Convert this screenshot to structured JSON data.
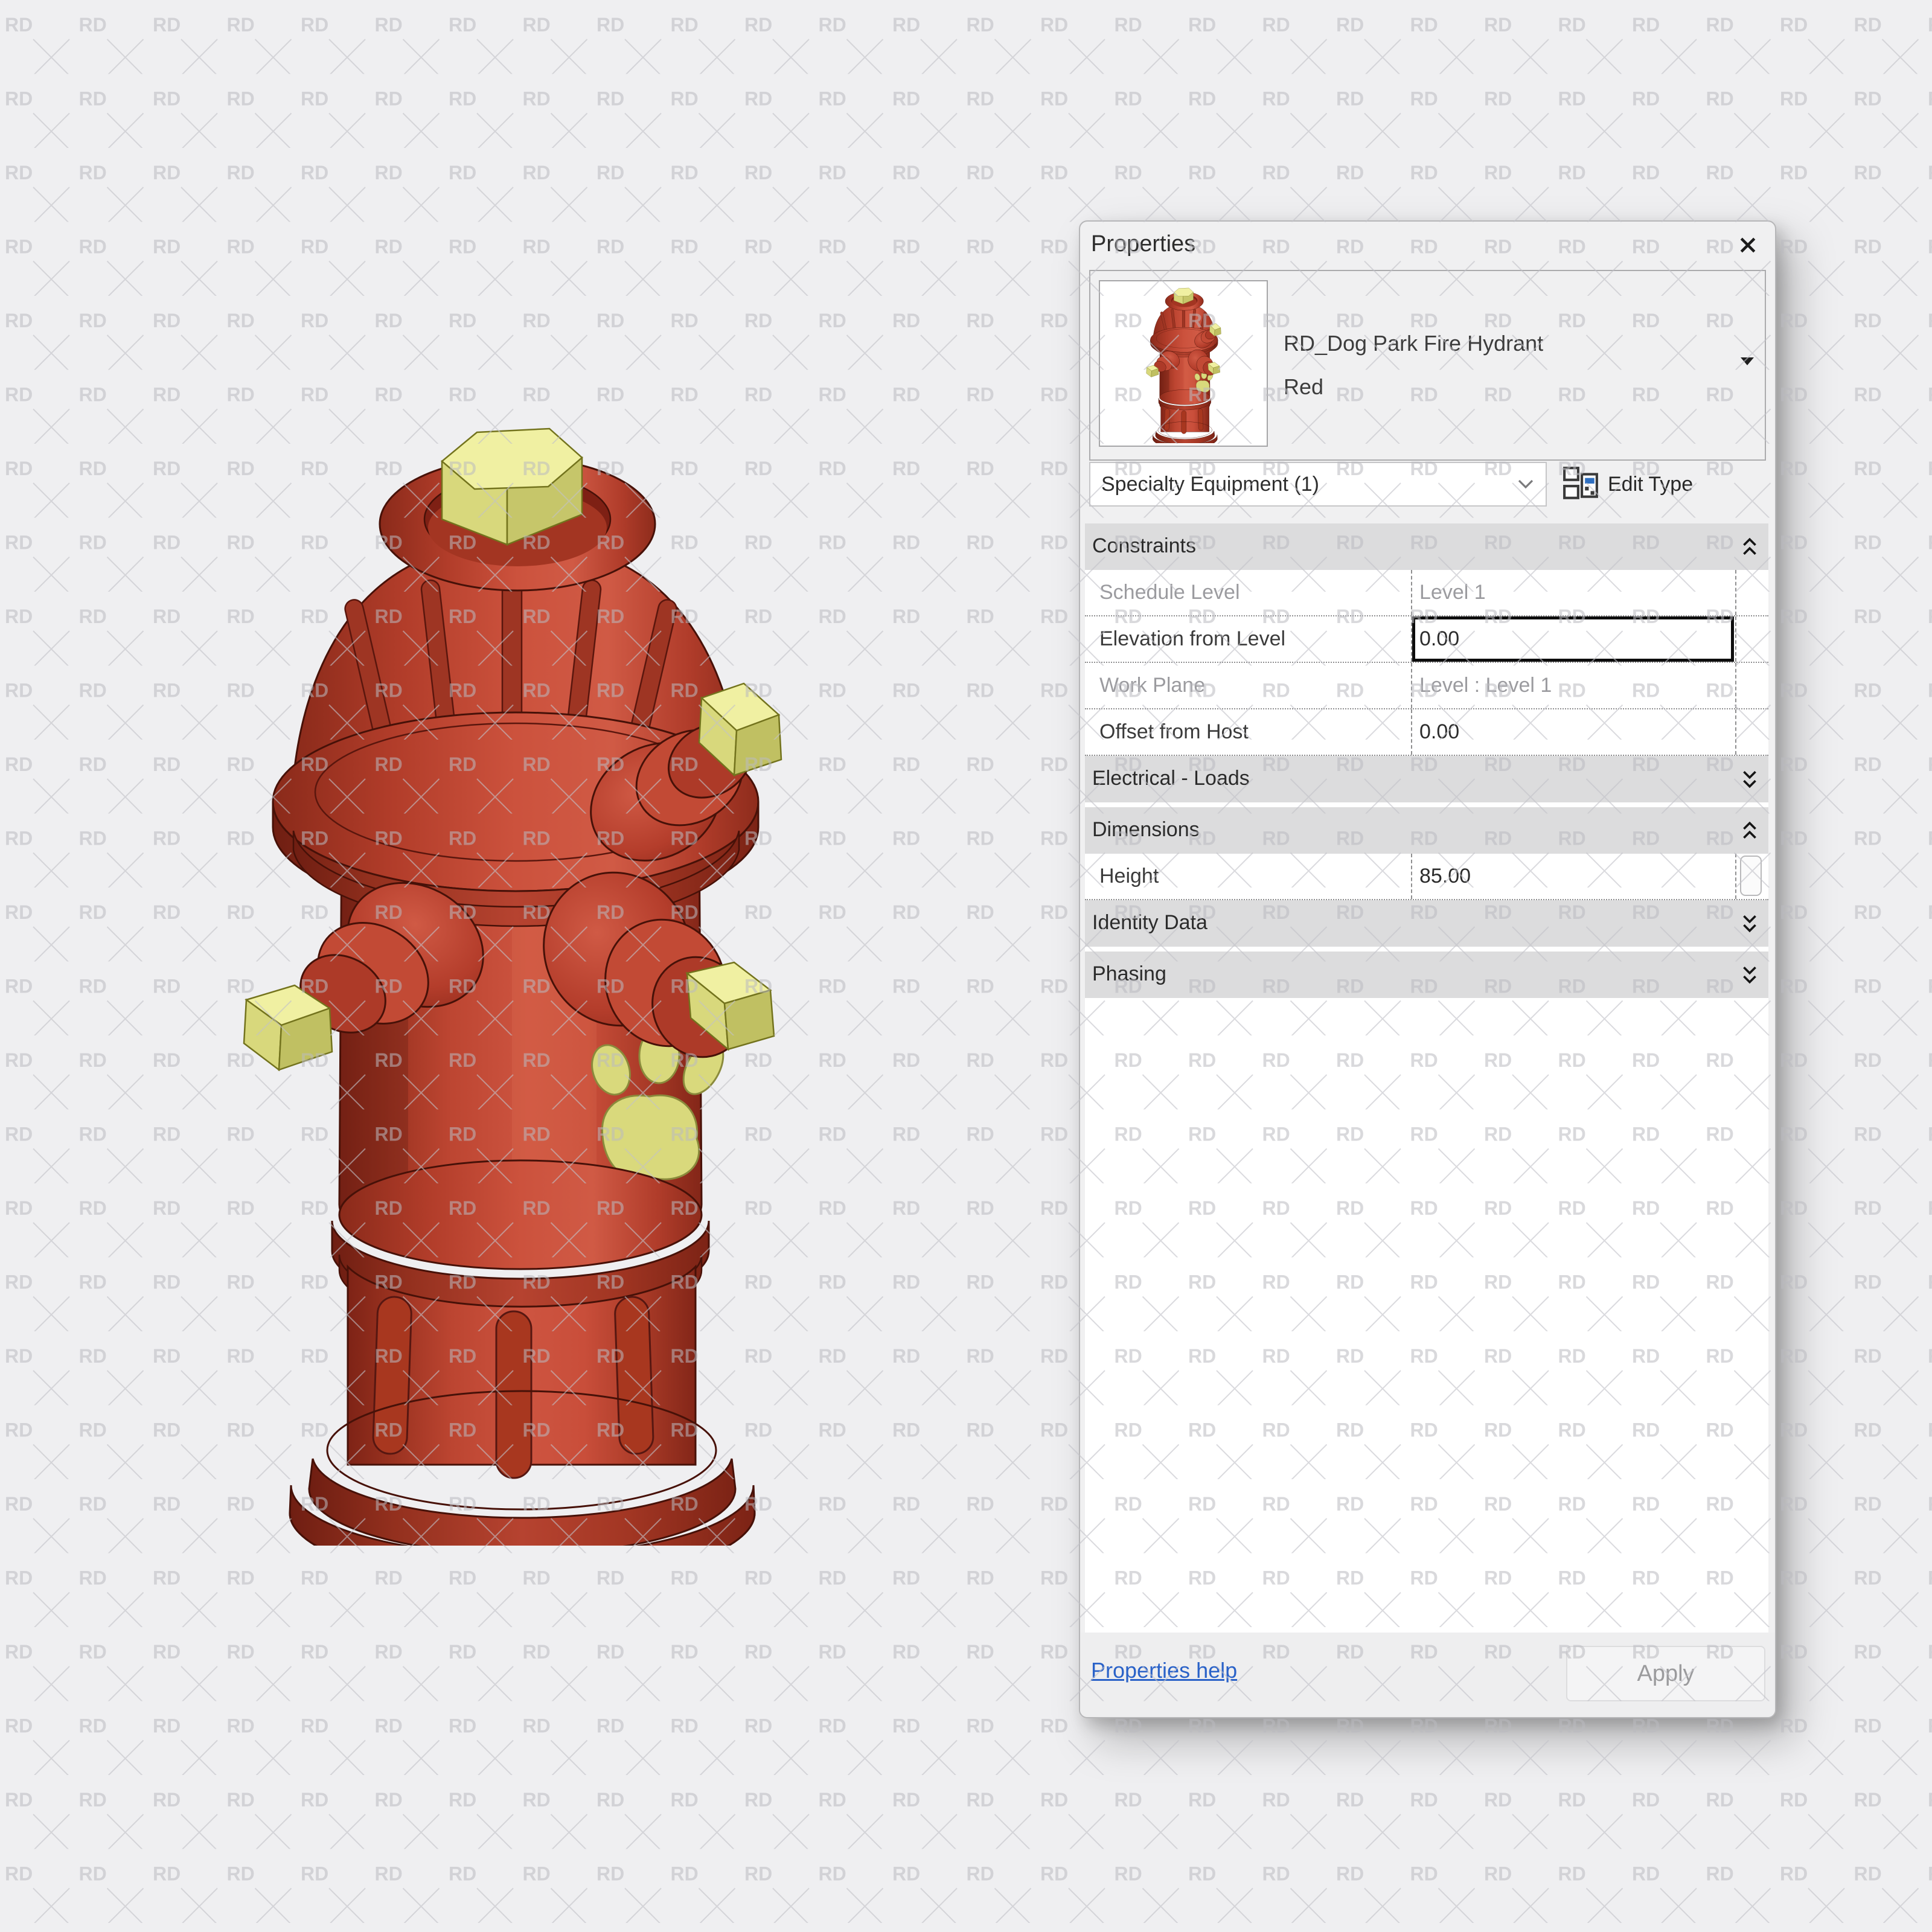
{
  "watermark": {
    "text": "RD"
  },
  "colors": {
    "hydrant_red": "#c0452f",
    "hydrant_cap_khaki": "#dede84",
    "link_blue": "#2a62c8",
    "section_header_gray": "#dcdcdd",
    "panel_bg": "#f0f0f1",
    "focus_border": "#0d0d0d"
  },
  "properties_panel": {
    "title": "Properties",
    "type_selector": {
      "family_name": "RD_Dog Park Fire Hydrant",
      "type_name": "Red"
    },
    "filter_combo": {
      "value": "Specialty Equipment (1)"
    },
    "edit_type_label": "Edit Type",
    "sections": [
      {
        "label": "Constraints",
        "state": "expanded",
        "rows": [
          {
            "label": "Schedule Level",
            "value": "Level 1",
            "editable": false
          },
          {
            "label": "Elevation from Level",
            "value": "0.00",
            "editable": true,
            "focused": true
          },
          {
            "label": "Work Plane",
            "value": "Level : Level 1",
            "editable": false
          },
          {
            "label": "Offset from Host",
            "value": "0.00",
            "editable": true
          }
        ]
      },
      {
        "label": "Electrical - Loads",
        "state": "collapsed",
        "rows": []
      },
      {
        "label": "Dimensions",
        "state": "expanded",
        "rows": [
          {
            "label": "Height",
            "value": "85.00",
            "editable": true
          }
        ]
      },
      {
        "label": "Identity Data",
        "state": "collapsed",
        "rows": []
      },
      {
        "label": "Phasing",
        "state": "collapsed",
        "rows": []
      }
    ],
    "footer": {
      "help_link": "Properties help",
      "apply_label": "Apply"
    }
  }
}
